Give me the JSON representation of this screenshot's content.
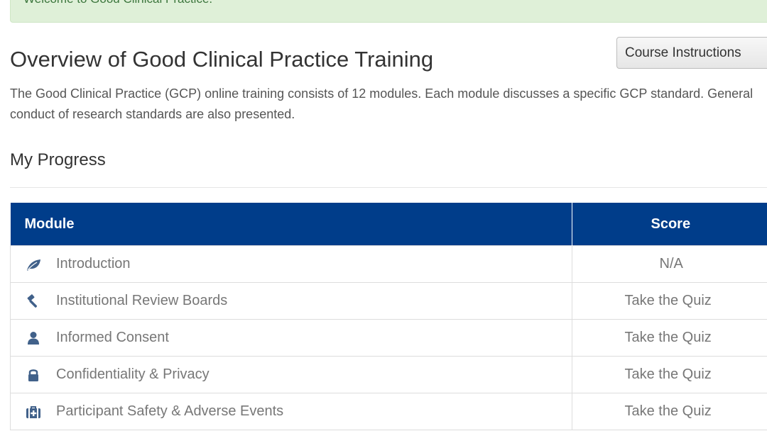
{
  "banner": {
    "text": "Welcome to Good Clinical Practice."
  },
  "header": {
    "title": "Overview of Good Clinical Practice Training",
    "course_instructions_label": "Course Instructions"
  },
  "description": {
    "text": "The Good Clinical Practice (GCP) online training consists of 12 modules. Each module discusses a specific GCP standard. General conduct of research standards are also presented."
  },
  "progress": {
    "title": "My Progress",
    "columns": {
      "module": "Module",
      "score": "Score"
    },
    "rows": [
      {
        "icon": "leaf-icon",
        "module": "Introduction",
        "score": "N/A"
      },
      {
        "icon": "gavel-icon",
        "module": "Institutional Review Boards",
        "score": "Take the Quiz"
      },
      {
        "icon": "user-icon",
        "module": "Informed Consent",
        "score": "Take the Quiz"
      },
      {
        "icon": "lock-icon",
        "module": "Confidentiality & Privacy",
        "score": "Take the Quiz"
      },
      {
        "icon": "medkit-icon",
        "module": "Participant Safety & Adverse Events",
        "score": "Take the Quiz"
      }
    ]
  },
  "colors": {
    "table_header_bg": "#003d8a",
    "banner_bg": "#dff0d8",
    "icon_color": "#41618a"
  }
}
